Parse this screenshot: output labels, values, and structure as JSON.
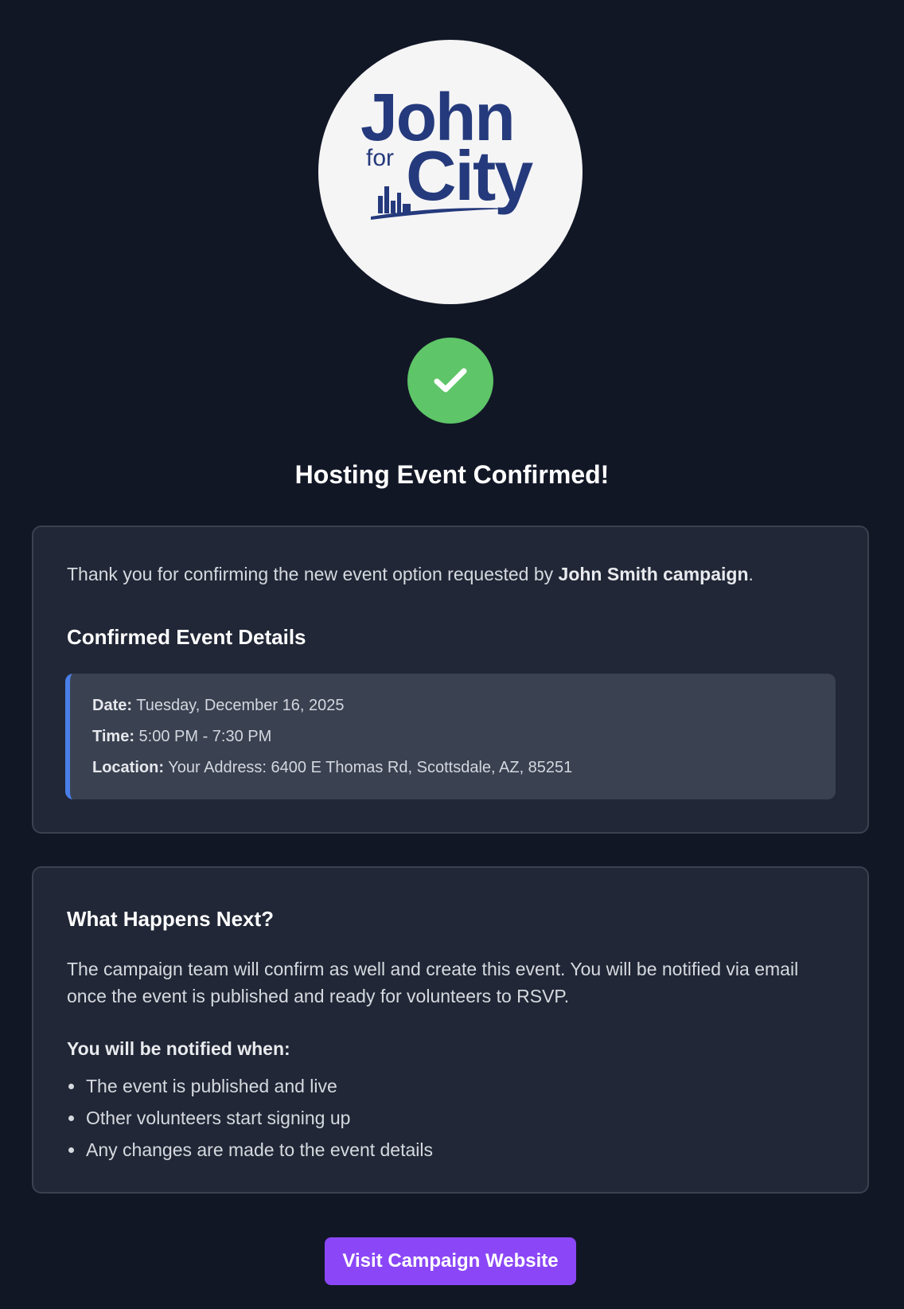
{
  "logo": {
    "line1": "John",
    "line2_small": "for",
    "line2_large": "City",
    "colors": {
      "text": "#253a7c",
      "background": "#f5f5f6"
    }
  },
  "status": {
    "icon": "checkmark-icon",
    "color": "#5ec568"
  },
  "title": "Hosting Event Confirmed!",
  "confirmation": {
    "intro_prefix": "Thank you for confirming the new event option requested by ",
    "intro_bold": "John Smith campaign",
    "intro_suffix": ".",
    "heading": "Confirmed Event Details",
    "details": {
      "date_label": "Date:",
      "date_value": "Tuesday, December 16, 2025",
      "time_label": "Time:",
      "time_value": "5:00 PM - 7:30 PM",
      "location_label": "Location:",
      "location_value": "Your Address: 6400 E Thomas Rd, Scottsdale, AZ, 85251"
    }
  },
  "next_steps": {
    "heading": "What Happens Next?",
    "paragraph": "The campaign team will confirm as well and create this event. You will be notified via email once the event is published and ready for volunteers to RSVP.",
    "notify_heading": "You will be notified when:",
    "items": [
      "The event is published and live",
      "Other volunteers start signing up",
      "Any changes are made to the event details"
    ]
  },
  "cta": {
    "label": "Visit Campaign Website",
    "color": "#8b47f7"
  },
  "colors": {
    "background": "#121726",
    "card": "#212736",
    "details_box": "#3a4151",
    "accent_bar": "#4a7ee8"
  }
}
